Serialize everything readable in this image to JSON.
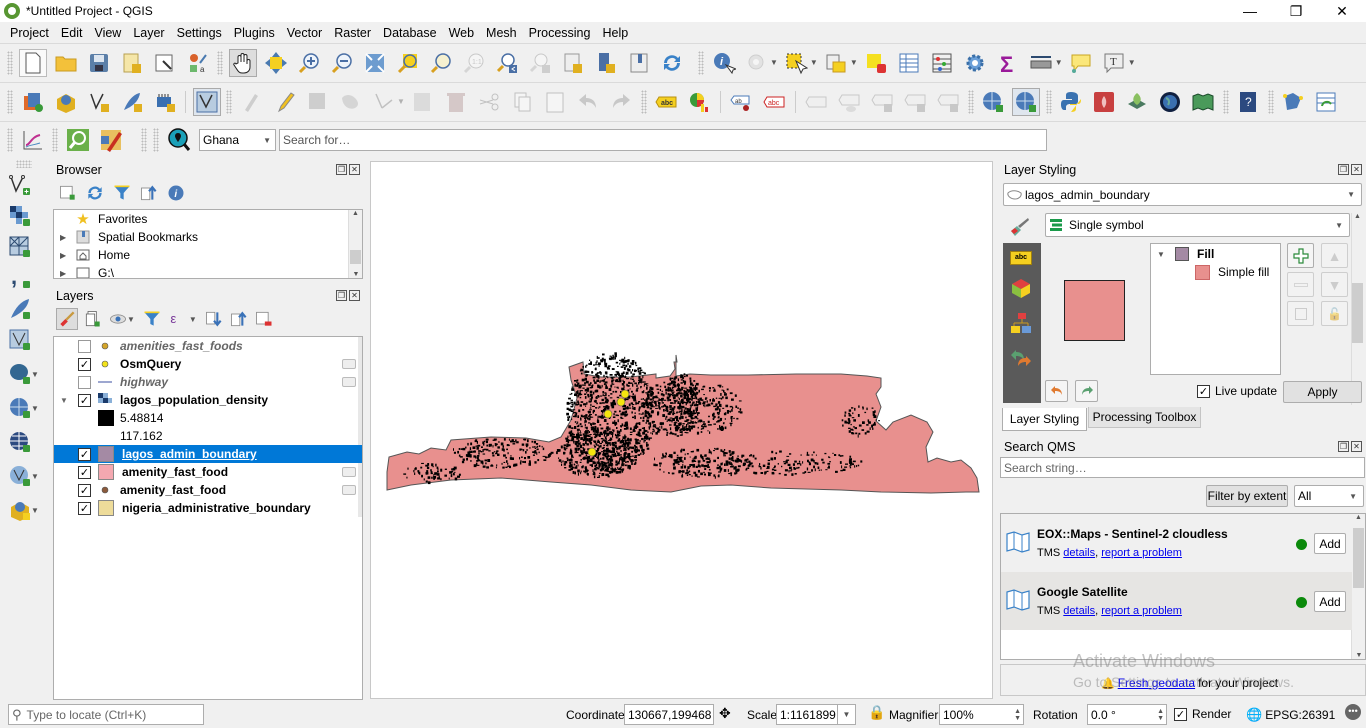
{
  "window": {
    "title": "*Untitled Project - QGIS",
    "controls": {
      "minimize": "—",
      "restore": "❐",
      "close": "✕"
    }
  },
  "menubar": [
    "Project",
    "Edit",
    "View",
    "Layer",
    "Settings",
    "Plugins",
    "Vector",
    "Raster",
    "Database",
    "Web",
    "Mesh",
    "Processing",
    "Help"
  ],
  "toolbars": {
    "row1": [
      "new-project",
      "open-project",
      "save-project",
      "new-print-layout",
      "layout-manager",
      "style-manager",
      "pan-map",
      "pan-to-selection",
      "zoom-in",
      "zoom-out",
      "zoom-full",
      "zoom-to-selection",
      "zoom-to-layer",
      "zoom-native",
      "zoom-last",
      "zoom-next",
      "new-map-view",
      "new-bookmark",
      "show-bookmarks",
      "refresh",
      "identify",
      "run-action",
      "select-features",
      "select-by-value",
      "deselect-all",
      "open-attribute-table",
      "field-calculator",
      "toolbox",
      "statistics",
      "measure",
      "map-tips",
      "text-annotation"
    ],
    "row2": [
      "data-source-manager",
      "new-geopackage",
      "new-shapefile",
      "new-temporary-scratch",
      "new-virtual-layer",
      "vertex-tool",
      "current-edits",
      "toggle-editing",
      "save-edits",
      "add-feature",
      "vertex-tool-all",
      "modify-attributes",
      "delete-selected",
      "cut-features",
      "copy-features",
      "paste-features",
      "undo",
      "redo",
      "label-tool",
      "diagram-tool",
      "highlight-pinned-labels",
      "pin-labels",
      "show-hide-labels",
      "move-label",
      "rotate-label",
      "change-label",
      "qms-add",
      "qms-search",
      "python-console",
      "firefly",
      "geopackage-tool",
      "globe",
      "quickosm",
      "help-contents",
      "georeferencer",
      "refresh-table"
    ],
    "row3": {
      "locator_value": "Ghana",
      "search_placeholder": "Search for…"
    }
  },
  "browser": {
    "title": "Browser",
    "items": [
      {
        "label": "Favorites",
        "icon": "star-icon",
        "expandable": false
      },
      {
        "label": "Spatial Bookmarks",
        "icon": "bookmark-icon",
        "expandable": true
      },
      {
        "label": "Home",
        "icon": "home-folder-icon",
        "expandable": true
      },
      {
        "label": "G:\\",
        "icon": "folder-icon",
        "expandable": true
      }
    ]
  },
  "layers": {
    "title": "Layers",
    "items": [
      {
        "name": "amenities_fast_foods",
        "checked": false,
        "italic": true,
        "symbol": "point",
        "color": "#d4a52a",
        "filter": false
      },
      {
        "name": "OsmQuery",
        "checked": true,
        "italic": false,
        "symbol": "point",
        "color": "#f2e21a",
        "filter": true
      },
      {
        "name": "highway",
        "checked": false,
        "italic": true,
        "symbol": "line",
        "color": "#3b4fa0",
        "filter": true
      },
      {
        "name": "lagos_population_density",
        "checked": true,
        "italic": false,
        "symbol": "raster",
        "color": "#4a6fa5",
        "filter": false,
        "expanded": true
      },
      {
        "name": "lagos_admin_boundary",
        "checked": true,
        "italic": false,
        "symbol": "fill",
        "color": "#a48aa4",
        "filter": false,
        "selected": true
      },
      {
        "name": "amenity_fast_food",
        "checked": true,
        "italic": false,
        "symbol": "fill",
        "color": "#f4a8b0",
        "filter": true
      },
      {
        "name": "amenity_fast_food",
        "checked": true,
        "italic": false,
        "symbol": "point",
        "color": "#8b5a3c",
        "filter": true
      },
      {
        "name": "nigeria_administrative_boundary",
        "checked": true,
        "italic": false,
        "symbol": "fill",
        "color": "#eedc9a",
        "filter": false
      }
    ],
    "raster_legend": [
      {
        "label": "5.48814",
        "color": "#000000"
      },
      {
        "label": "117.162",
        "color": "#ffffff"
      }
    ]
  },
  "map": {
    "fill_color": "#e8908e",
    "outline_color": "#555555",
    "density_color": "#000000",
    "point_color": "#f5e50f"
  },
  "styling": {
    "title": "Layer Styling",
    "layer": "lagos_admin_boundary",
    "renderer": "Single symbol",
    "symbol_tree": [
      {
        "label": "Fill",
        "color": "#a48aa4",
        "bold": true
      },
      {
        "label": "Simple fill",
        "color": "#e8908e",
        "bold": false
      }
    ],
    "preview_color": "#e8908e",
    "live_update_label": "Live update",
    "live_update_checked": true,
    "apply_label": "Apply",
    "tabs": [
      "Layer Styling",
      "Processing Toolbox"
    ],
    "active_tab": "Layer Styling"
  },
  "qms": {
    "title": "Search QMS",
    "search_placeholder": "Search string…",
    "filter_button": "Filter by extent",
    "filter_select": "All",
    "results": [
      {
        "name": "EOX::Maps - Sentinel-2 cloudless",
        "type": "TMS",
        "details": "details",
        "report": "report a problem",
        "status": "#0b8a0b",
        "add": "Add"
      },
      {
        "name": "Google Satellite",
        "type": "TMS",
        "details": "details",
        "report": "report a problem",
        "status": "#0b8a0b",
        "add": "Add"
      }
    ],
    "footer_link": "Fresh geodata",
    "footer_text": "for your project"
  },
  "watermark": {
    "line1": "Activate Windows",
    "line2": "Go to Settings to activate Windows."
  },
  "statusbar": {
    "locator_placeholder": "Type to locate (Ctrl+K)",
    "coordinate_label": "Coordinate",
    "coordinate_value": "130667,199468",
    "scale_label": "Scale",
    "scale_value": "1:1161899",
    "magnifier_label": "Magnifier",
    "magnifier_value": "100%",
    "rotation_label": "Rotation",
    "rotation_value": "0.0 °",
    "render_label": "Render",
    "render_checked": true,
    "crs": "EPSG:26391"
  }
}
